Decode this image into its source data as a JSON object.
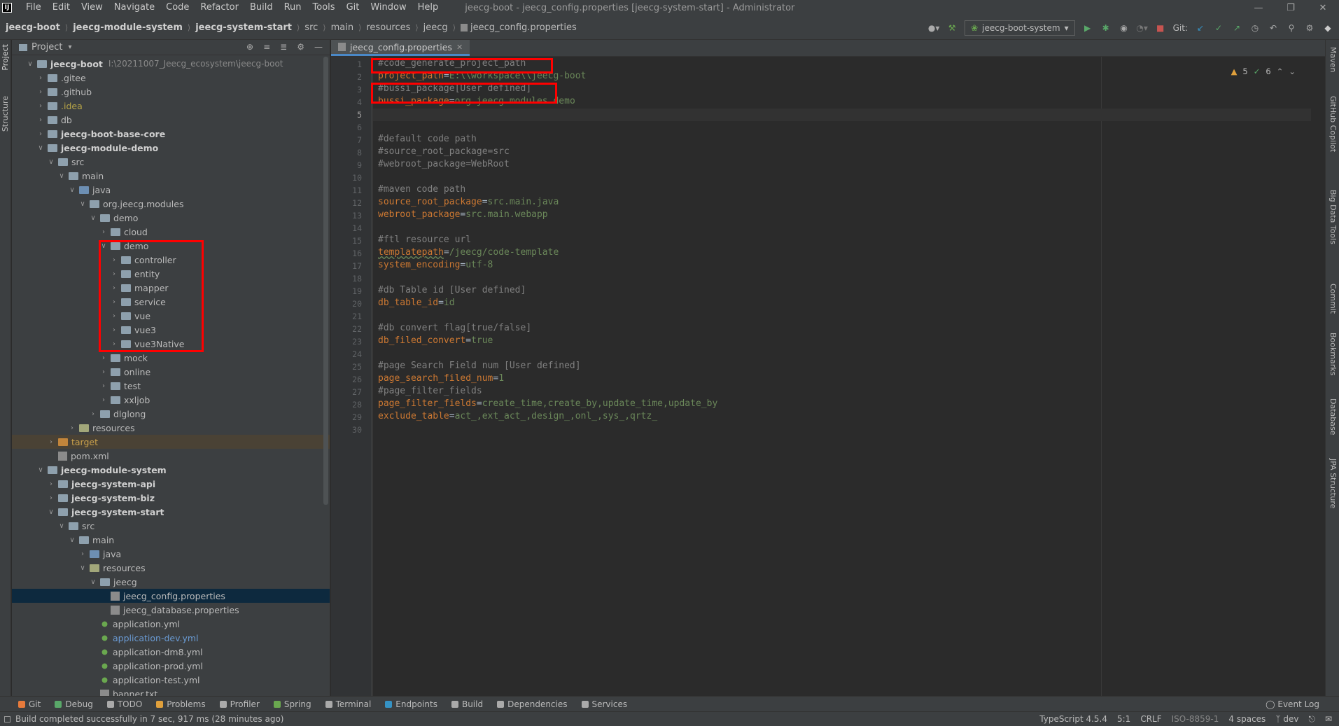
{
  "menubar": {
    "items": [
      "File",
      "Edit",
      "View",
      "Navigate",
      "Code",
      "Refactor",
      "Build",
      "Run",
      "Tools",
      "Git",
      "Window",
      "Help"
    ],
    "window_title": "jeecg-boot - jeecg_config.properties [jeecg-system-start] - Administrator"
  },
  "breadcrumb": [
    "jeecg-boot",
    "jeecg-module-system",
    "jeecg-system-start",
    "src",
    "main",
    "resources",
    "jeecg",
    "jeecg_config.properties"
  ],
  "run_config": "jeecg-boot-system",
  "git_label": "Git:",
  "left_stripe": [
    "Project",
    "Structure"
  ],
  "right_stripe": [
    "Maven",
    "GitHub Copilot",
    "Big Data Tools",
    "Commit",
    "Bookmarks",
    "Database",
    "JPA Structure"
  ],
  "project_panel": {
    "title": "Project",
    "root_path": "I:\\20211007_Jeecg_ecosystem\\jeecg-boot",
    "tree": [
      {
        "label": "jeecg-boot",
        "depth": 0,
        "open": true,
        "kind": "module",
        "bold": true
      },
      {
        "label": ".gitee",
        "depth": 1,
        "kind": "folder"
      },
      {
        "label": ".github",
        "depth": 1,
        "kind": "folder"
      },
      {
        "label": ".idea",
        "depth": 1,
        "kind": "folder",
        "color": "yellow"
      },
      {
        "label": "db",
        "depth": 1,
        "kind": "folder"
      },
      {
        "label": "jeecg-boot-base-core",
        "depth": 1,
        "kind": "module",
        "bold": true
      },
      {
        "label": "jeecg-module-demo",
        "depth": 1,
        "open": true,
        "kind": "module",
        "bold": true
      },
      {
        "label": "src",
        "depth": 2,
        "open": true,
        "kind": "folder"
      },
      {
        "label": "main",
        "depth": 3,
        "open": true,
        "kind": "folder"
      },
      {
        "label": "java",
        "depth": 4,
        "open": true,
        "kind": "src"
      },
      {
        "label": "org.jeecg.modules",
        "depth": 5,
        "open": true,
        "kind": "folder"
      },
      {
        "label": "demo",
        "depth": 6,
        "open": true,
        "kind": "folder"
      },
      {
        "label": "cloud",
        "depth": 7,
        "kind": "folder"
      },
      {
        "label": "demo",
        "depth": 7,
        "open": true,
        "kind": "folder"
      },
      {
        "label": "controller",
        "depth": 8,
        "kind": "folder"
      },
      {
        "label": "entity",
        "depth": 8,
        "kind": "folder"
      },
      {
        "label": "mapper",
        "depth": 8,
        "kind": "folder"
      },
      {
        "label": "service",
        "depth": 8,
        "kind": "folder"
      },
      {
        "label": "vue",
        "depth": 8,
        "kind": "folder"
      },
      {
        "label": "vue3",
        "depth": 8,
        "kind": "folder"
      },
      {
        "label": "vue3Native",
        "depth": 8,
        "kind": "folder"
      },
      {
        "label": "mock",
        "depth": 7,
        "kind": "folder"
      },
      {
        "label": "online",
        "depth": 7,
        "kind": "folder"
      },
      {
        "label": "test",
        "depth": 7,
        "kind": "folder"
      },
      {
        "label": "xxljob",
        "depth": 7,
        "kind": "folder"
      },
      {
        "label": "dlglong",
        "depth": 6,
        "kind": "folder"
      },
      {
        "label": "resources",
        "depth": 4,
        "kind": "res"
      },
      {
        "label": "target",
        "depth": 2,
        "kind": "orange",
        "color": "orange",
        "row": "orange"
      },
      {
        "label": "pom.xml",
        "depth": 2,
        "kind": "file",
        "noarrow": true
      },
      {
        "label": "jeecg-module-system",
        "depth": 1,
        "open": true,
        "kind": "module",
        "bold": true
      },
      {
        "label": "jeecg-system-api",
        "depth": 2,
        "kind": "module",
        "bold": true
      },
      {
        "label": "jeecg-system-biz",
        "depth": 2,
        "kind": "module",
        "bold": true
      },
      {
        "label": "jeecg-system-start",
        "depth": 2,
        "open": true,
        "kind": "module",
        "bold": true
      },
      {
        "label": "src",
        "depth": 3,
        "open": true,
        "kind": "folder"
      },
      {
        "label": "main",
        "depth": 4,
        "open": true,
        "kind": "folder"
      },
      {
        "label": "java",
        "depth": 5,
        "kind": "src"
      },
      {
        "label": "resources",
        "depth": 5,
        "open": true,
        "kind": "res"
      },
      {
        "label": "jeecg",
        "depth": 6,
        "open": true,
        "kind": "folder"
      },
      {
        "label": "jeecg_config.properties",
        "depth": 7,
        "kind": "file",
        "noarrow": true,
        "row": "selected"
      },
      {
        "label": "jeecg_database.properties",
        "depth": 7,
        "kind": "file",
        "noarrow": true
      },
      {
        "label": "application.yml",
        "depth": 6,
        "kind": "yml",
        "noarrow": true
      },
      {
        "label": "application-dev.yml",
        "depth": 6,
        "kind": "yml",
        "noarrow": true,
        "color": "blue"
      },
      {
        "label": "application-dm8.yml",
        "depth": 6,
        "kind": "yml",
        "noarrow": true
      },
      {
        "label": "application-prod.yml",
        "depth": 6,
        "kind": "yml",
        "noarrow": true
      },
      {
        "label": "application-test.yml",
        "depth": 6,
        "kind": "yml",
        "noarrow": true
      },
      {
        "label": "banner.txt",
        "depth": 6,
        "kind": "file",
        "noarrow": true
      }
    ]
  },
  "editor": {
    "tab_label": "jeecg_config.properties",
    "inspections": {
      "warnings": "5",
      "weak": "6"
    },
    "lines": [
      [
        {
          "t": "#code_generate_project_path",
          "c": "cm"
        }
      ],
      [
        {
          "t": "project_path",
          "c": "key"
        },
        {
          "t": "=",
          "c": "eq"
        },
        {
          "t": "E:\\\\workspace\\\\jeecg-boot",
          "c": "val"
        }
      ],
      [
        {
          "t": "#bussi_package[User defined]",
          "c": "cm"
        }
      ],
      [
        {
          "t": "bussi_package",
          "c": "key"
        },
        {
          "t": "=",
          "c": "eq"
        },
        {
          "t": "org.jeecg.modules.demo",
          "c": "val"
        }
      ],
      [],
      [],
      [
        {
          "t": "#default code path",
          "c": "cm"
        }
      ],
      [
        {
          "t": "#source_root_package=src",
          "c": "cm"
        }
      ],
      [
        {
          "t": "#webroot_package=WebRoot",
          "c": "cm"
        }
      ],
      [],
      [
        {
          "t": "#maven code path",
          "c": "cm"
        }
      ],
      [
        {
          "t": "source_root_package",
          "c": "key"
        },
        {
          "t": "=",
          "c": "eq"
        },
        {
          "t": "src.main.java",
          "c": "val"
        }
      ],
      [
        {
          "t": "webroot_package",
          "c": "key"
        },
        {
          "t": "=",
          "c": "eq"
        },
        {
          "t": "src.main.webapp",
          "c": "val"
        }
      ],
      [],
      [
        {
          "t": "#ftl resource url",
          "c": "cm"
        }
      ],
      [
        {
          "t": "templatepath",
          "c": "key-u"
        },
        {
          "t": "=",
          "c": "eq"
        },
        {
          "t": "/jeecg/code-template",
          "c": "val"
        }
      ],
      [
        {
          "t": "system_encoding",
          "c": "key"
        },
        {
          "t": "=",
          "c": "eq"
        },
        {
          "t": "utf-8",
          "c": "val"
        }
      ],
      [],
      [
        {
          "t": "#db Table id [User defined]",
          "c": "cm"
        }
      ],
      [
        {
          "t": "db_table_id",
          "c": "key"
        },
        {
          "t": "=",
          "c": "eq"
        },
        {
          "t": "id",
          "c": "val"
        }
      ],
      [],
      [
        {
          "t": "#db convert flag[true/false]",
          "c": "cm"
        }
      ],
      [
        {
          "t": "db_filed_convert",
          "c": "key"
        },
        {
          "t": "=",
          "c": "eq"
        },
        {
          "t": "true",
          "c": "val"
        }
      ],
      [],
      [
        {
          "t": "#page Search Field num [User defined]",
          "c": "cm"
        }
      ],
      [
        {
          "t": "page_search_filed_num",
          "c": "key"
        },
        {
          "t": "=",
          "c": "eq"
        },
        {
          "t": "1",
          "c": "val"
        }
      ],
      [
        {
          "t": "#page_filter_fields",
          "c": "cm"
        }
      ],
      [
        {
          "t": "page_filter_fields",
          "c": "key"
        },
        {
          "t": "=",
          "c": "eq"
        },
        {
          "t": "create_time,create_by,update_time,update_by",
          "c": "val"
        }
      ],
      [
        {
          "t": "exclude_table",
          "c": "key"
        },
        {
          "t": "=",
          "c": "eq"
        },
        {
          "t": "act_,ext_act_,design_,onl_,sys_,qrtz_",
          "c": "val"
        }
      ],
      []
    ],
    "active_line": "5"
  },
  "bottom_tools": [
    "Git",
    "Debug",
    "TODO",
    "Problems",
    "Profiler",
    "Spring",
    "Terminal",
    "Endpoints",
    "Build",
    "Dependencies",
    "Services"
  ],
  "event_log": "Event Log",
  "status": {
    "message": "Build completed successfully in 7 sec, 917 ms (28 minutes ago)",
    "typescript": "TypeScript 4.5.4",
    "position": "5:1",
    "line_sep": "CRLF",
    "encoding": "ISO-8859-1",
    "indent": "4 spaces",
    "branch": "dev"
  },
  "colors": {
    "accent": "#4a88c7",
    "highlight_box": "#ff0000"
  }
}
